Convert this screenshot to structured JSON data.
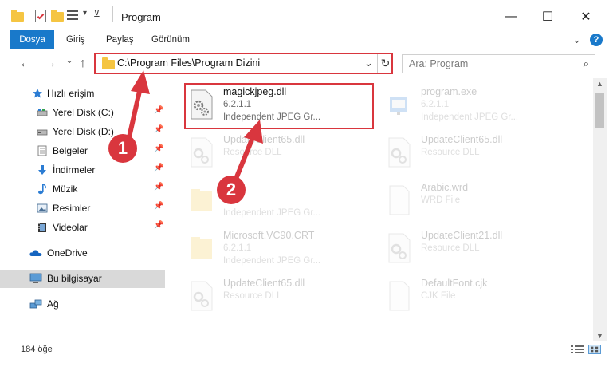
{
  "window": {
    "title": "Program",
    "minimize": "—",
    "maximize": "☐",
    "close": "✕"
  },
  "menu": {
    "file": "Dosya",
    "home": "Giriş",
    "share": "Paylaş",
    "view": "Görünüm",
    "expand": "⌄",
    "help": "?"
  },
  "nav": {
    "back": "←",
    "forward": "→",
    "recent": "⌄",
    "up": "↑",
    "address": "C:\\Program Files\\Program Dizini",
    "dropdown": "⌄",
    "refresh": "↻",
    "search_placeholder": "Ara: Program",
    "search_icon": "⌕"
  },
  "sidebar": {
    "items": [
      {
        "label": "Hızlı erişim",
        "icon": "star-icon",
        "pinned": false
      },
      {
        "label": "Yerel Disk (C:)",
        "icon": "drive-icon",
        "pinned": true
      },
      {
        "label": "Yerel Disk (D:)",
        "icon": "drive-icon",
        "pinned": true
      },
      {
        "label": "Belgeler",
        "icon": "documents-icon",
        "pinned": true
      },
      {
        "label": "İndirmeler",
        "icon": "download-icon",
        "pinned": true
      },
      {
        "label": "Müzik",
        "icon": "music-icon",
        "pinned": true
      },
      {
        "label": "Resimler",
        "icon": "pictures-icon",
        "pinned": true
      },
      {
        "label": "Videolar",
        "icon": "videos-icon",
        "pinned": true
      },
      {
        "label": "OneDrive",
        "icon": "cloud-icon",
        "pinned": false
      },
      {
        "label": "Bu bilgisayar",
        "icon": "computer-icon",
        "pinned": false
      },
      {
        "label": "Ağ",
        "icon": "network-icon",
        "pinned": false
      }
    ],
    "pin_glyph": "📌"
  },
  "files": [
    {
      "name": "magickjpeg.dll",
      "line2": "6.2.1.1",
      "line3": "Independent JPEG Gr...",
      "icon": "dll-gear-icon"
    },
    {
      "name": "program.exe",
      "line2": "6.2.1.1",
      "line3": "Independent JPEG Gr...",
      "icon": "exe-icon"
    },
    {
      "name": "UpdateClient65.dll",
      "line2": "Resource DLL",
      "line3": "",
      "icon": "dll-gear-icon"
    },
    {
      "name": "UpdateClient65.dll",
      "line2": "Resource DLL",
      "line3": "",
      "icon": "dll-gear-icon"
    },
    {
      "name": "",
      "line2": "",
      "line3": "Independent JPEG Gr...",
      "icon": "folder-icon"
    },
    {
      "name": "Arabic.wrd",
      "line2": "WRD File",
      "line3": "",
      "icon": "blank-file-icon"
    },
    {
      "name": "Microsoft.VC90.CRT",
      "line2": "6.2.1.1",
      "line3": "Independent JPEG Gr...",
      "icon": "folder-icon"
    },
    {
      "name": "UpdateClient21.dll",
      "line2": "Resource DLL",
      "line3": "",
      "icon": "dll-gear-icon"
    },
    {
      "name": "UpdateClient65.dll",
      "line2": "Resource DLL",
      "line3": "",
      "icon": "dll-gear-icon"
    },
    {
      "name": "DefaultFont.cjk",
      "line2": "CJK File",
      "line3": "",
      "icon": "blank-file-icon"
    }
  ],
  "status": {
    "count": "184 öğe"
  },
  "annotations": {
    "step1": "1",
    "step2": "2"
  },
  "colors": {
    "accent": "#1979ca",
    "highlight": "#d9363e",
    "folder": "#f5c542"
  }
}
